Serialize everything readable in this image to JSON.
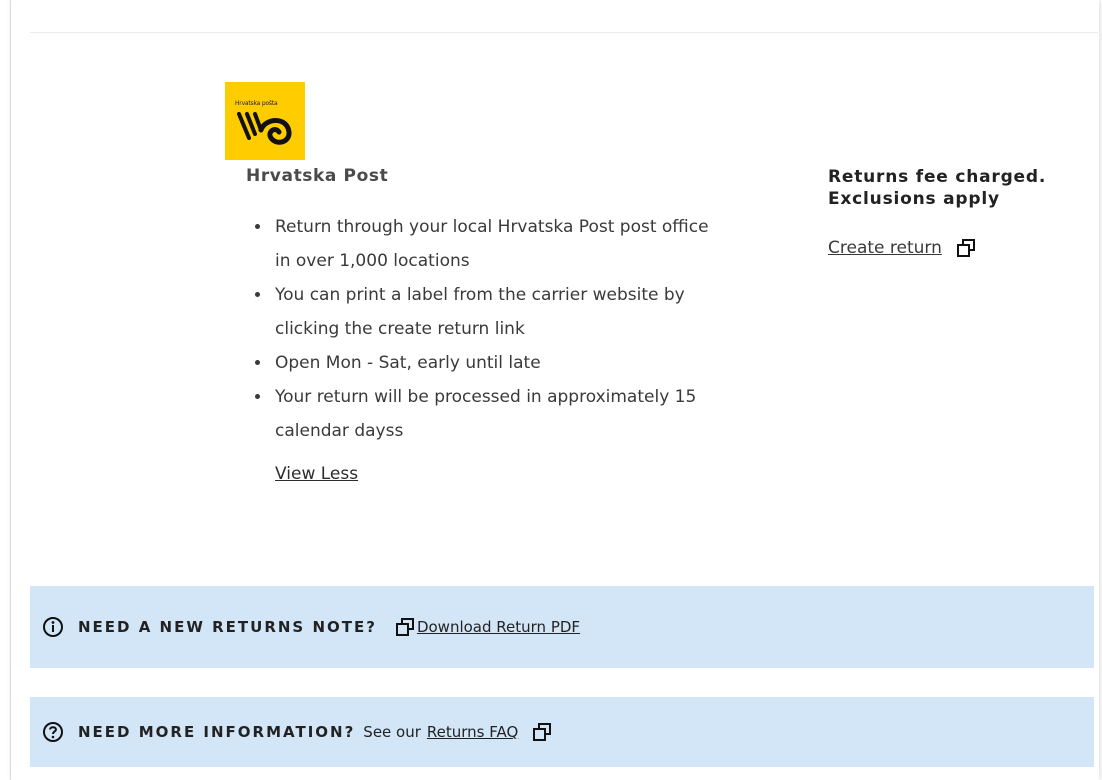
{
  "carrier": {
    "logo_text": "Hrvatska pošta",
    "name": "Hrvatska Post",
    "details": [
      "Return through your local Hrvatska Post post office in over 1,000 locations",
      "You can print a label from the carrier website by clicking the create return link",
      "Open Mon - Sat, early until late",
      "Your return will be processed in approximately 15 calendar dayss"
    ],
    "view_less_label": "View Less"
  },
  "fee": {
    "line1": "Returns fee charged.",
    "line2": "Exclusions apply",
    "create_return_label": "Create return"
  },
  "banners": {
    "returns_note": {
      "heading": "NEED A NEW RETURNS NOTE?",
      "link_label": "Download Return PDF"
    },
    "more_info": {
      "heading": "NEED MORE INFORMATION?",
      "prefix": "See our",
      "link_label": "Returns FAQ"
    }
  },
  "colors": {
    "banner_bg": "#d2e6f8",
    "logo_bg": "#ffcc00"
  },
  "icons": {
    "external": "external-link-icon",
    "info": "info-icon",
    "help": "question-icon"
  }
}
